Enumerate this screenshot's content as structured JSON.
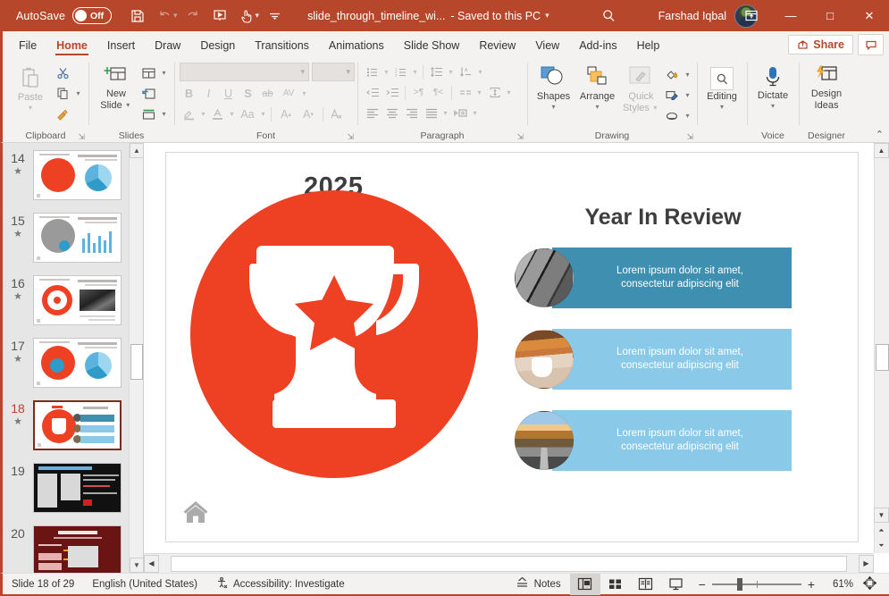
{
  "titlebar": {
    "autosave_label": "AutoSave",
    "autosave_state": "Off",
    "icons": [
      "save-icon",
      "undo-icon",
      "redo-icon",
      "start-slideshow-icon",
      "touch-mode-icon",
      "customize-quick-access-icon"
    ],
    "filename": "slide_through_timeline_wi...",
    "saved_state": "- Saved to this PC",
    "search_icon": "search-icon",
    "user_name": "Farshad Iqbal",
    "ribbon_display_icon": "ribbon-display-options-icon",
    "minimize": "—",
    "maximize": "□",
    "close": "✕"
  },
  "tabs": [
    {
      "label": "File",
      "active": false
    },
    {
      "label": "Home",
      "active": true
    },
    {
      "label": "Insert",
      "active": false
    },
    {
      "label": "Draw",
      "active": false
    },
    {
      "label": "Design",
      "active": false
    },
    {
      "label": "Transitions",
      "active": false
    },
    {
      "label": "Animations",
      "active": false
    },
    {
      "label": "Slide Show",
      "active": false
    },
    {
      "label": "Review",
      "active": false
    },
    {
      "label": "View",
      "active": false
    },
    {
      "label": "Add-ins",
      "active": false
    },
    {
      "label": "Help",
      "active": false
    }
  ],
  "tabbar_right": {
    "share_label": "Share",
    "comment_icon": "comment-icon"
  },
  "ribbon": {
    "groups": [
      {
        "name": "Clipboard",
        "label": "Clipboard"
      },
      {
        "name": "Slides",
        "label": "Slides"
      },
      {
        "name": "Font",
        "label": "Font"
      },
      {
        "name": "Paragraph",
        "label": "Paragraph"
      },
      {
        "name": "Drawing",
        "label": "Drawing"
      },
      {
        "name": "Voice",
        "label": "Voice"
      },
      {
        "name": "Designer",
        "label": "Designer"
      }
    ],
    "clipboard": {
      "paste_label": "Paste",
      "cut_icon": "scissors-icon",
      "copy_icon": "copy-icon",
      "format_painter_icon": "format-painter-icon"
    },
    "slides": {
      "new_slide_label": "New\nSlide",
      "new_slide_line1": "New",
      "new_slide_line2": "Slide",
      "layout_icon": "slide-layout-icon",
      "reset_icon": "reset-slide-icon",
      "section_icon": "section-icon"
    },
    "font": {
      "font_name_value": "",
      "font_size_value": "",
      "bold": "B",
      "italic": "I",
      "underline": "U",
      "shadow": "S",
      "strikethrough": "ab",
      "char_spacing": "AV",
      "text_highlight_icon": "text-highlight-icon",
      "font_color_icon": "font-color-icon",
      "change_case": "Aa",
      "increase_font": "A",
      "decrease_font": "A",
      "clear_formatting_icon": "clear-formatting-icon"
    },
    "paragraph": {
      "bullets_icon": "bullets-icon",
      "numbering_icon": "numbering-icon",
      "line_spacing_icon": "line-spacing-icon",
      "text_direction_icon": "text-direction-icon",
      "decrease_indent_icon": "decrease-indent-icon",
      "increase_indent_icon": "increase-indent-icon",
      "ltr_icon": "left-to-right-icon",
      "rtl_icon": "right-to-left-icon",
      "columns_icon": "columns-icon",
      "align_text_icon": "align-text-icon",
      "align_left_icon": "align-left-icon",
      "align_center_icon": "align-center-icon",
      "align_right_icon": "align-right-icon",
      "justify_icon": "justify-icon",
      "smartart_icon": "convert-to-smartart-icon"
    },
    "drawing": {
      "shapes_label": "Shapes",
      "arrange_label": "Arrange",
      "quick_styles_line1": "Quick",
      "quick_styles_line2": "Styles",
      "shape_fill_icon": "shape-fill-icon",
      "shape_outline_icon": "shape-outline-icon",
      "shape_effects_icon": "shape-effects-icon"
    },
    "editing": {
      "label": "Editing",
      "icon": "find-magnifier-icon"
    },
    "voice": {
      "dictate_label": "Dictate",
      "icon": "microphone-icon"
    },
    "designer": {
      "line1": "Design",
      "line2": "Ideas",
      "icon": "design-ideas-icon"
    },
    "collapse_icon": "collapse-ribbon-icon"
  },
  "thumbnails": [
    {
      "number": "14",
      "starred": true,
      "selected": false,
      "kind": "piggy-pie"
    },
    {
      "number": "15",
      "starred": true,
      "selected": false,
      "kind": "question-bars"
    },
    {
      "number": "16",
      "starred": true,
      "selected": false,
      "kind": "clock-photo"
    },
    {
      "number": "17",
      "starred": true,
      "selected": false,
      "kind": "globe-pie"
    },
    {
      "number": "18",
      "starred": true,
      "selected": true,
      "kind": "trophy-review"
    },
    {
      "number": "19",
      "starred": false,
      "selected": false,
      "kind": "dark-screens"
    },
    {
      "number": "20",
      "starred": false,
      "selected": false,
      "kind": "maroon-diagram"
    }
  ],
  "slide": {
    "year": "2025",
    "heading": "Year In Review",
    "trophy_icon": "trophy-icon",
    "home_icon": "home-icon",
    "rows": [
      {
        "text_line1": "Lorem ipsum dolor sit amet,",
        "text_line2": "consectetur adipiscing elit",
        "color": "#3E8FB0",
        "image": "city-windows-photo"
      },
      {
        "text_line1": "Lorem ipsum dolor sit amet,",
        "text_line2": "consectetur adipiscing elit",
        "color": "#8BC9E8",
        "image": "coffee-cup-photo"
      },
      {
        "text_line1": "Lorem ipsum dolor sit amet,",
        "text_line2": "consectetur adipiscing elit",
        "color": "#8BC9E8",
        "image": "autumn-road-photo"
      }
    ]
  },
  "statusbar": {
    "slide_counter": "Slide 18 of 29",
    "language": "English (United States)",
    "accessibility_icon": "accessibility-icon",
    "accessibility": "Accessibility: Investigate",
    "notes_label": "Notes",
    "notes_icon": "notes-icon",
    "views": [
      {
        "name": "normal-view",
        "icon": "normal-view-icon",
        "active": true
      },
      {
        "name": "slide-sorter-view",
        "icon": "slide-sorter-icon",
        "active": false
      },
      {
        "name": "reading-view",
        "icon": "reading-view-icon",
        "active": false
      },
      {
        "name": "slideshow-view",
        "icon": "slideshow-icon",
        "active": false
      }
    ],
    "zoom_out": "−",
    "zoom_in": "+",
    "zoom_level": "61%",
    "fit_icon": "fit-slide-icon"
  },
  "colors": {
    "accent_red": "#B7472A",
    "slide_red": "#EE4023",
    "row_dark_blue": "#3E8FB0",
    "row_light_blue": "#8BC9E8",
    "ribbon_bg": "#F3F2F1"
  }
}
